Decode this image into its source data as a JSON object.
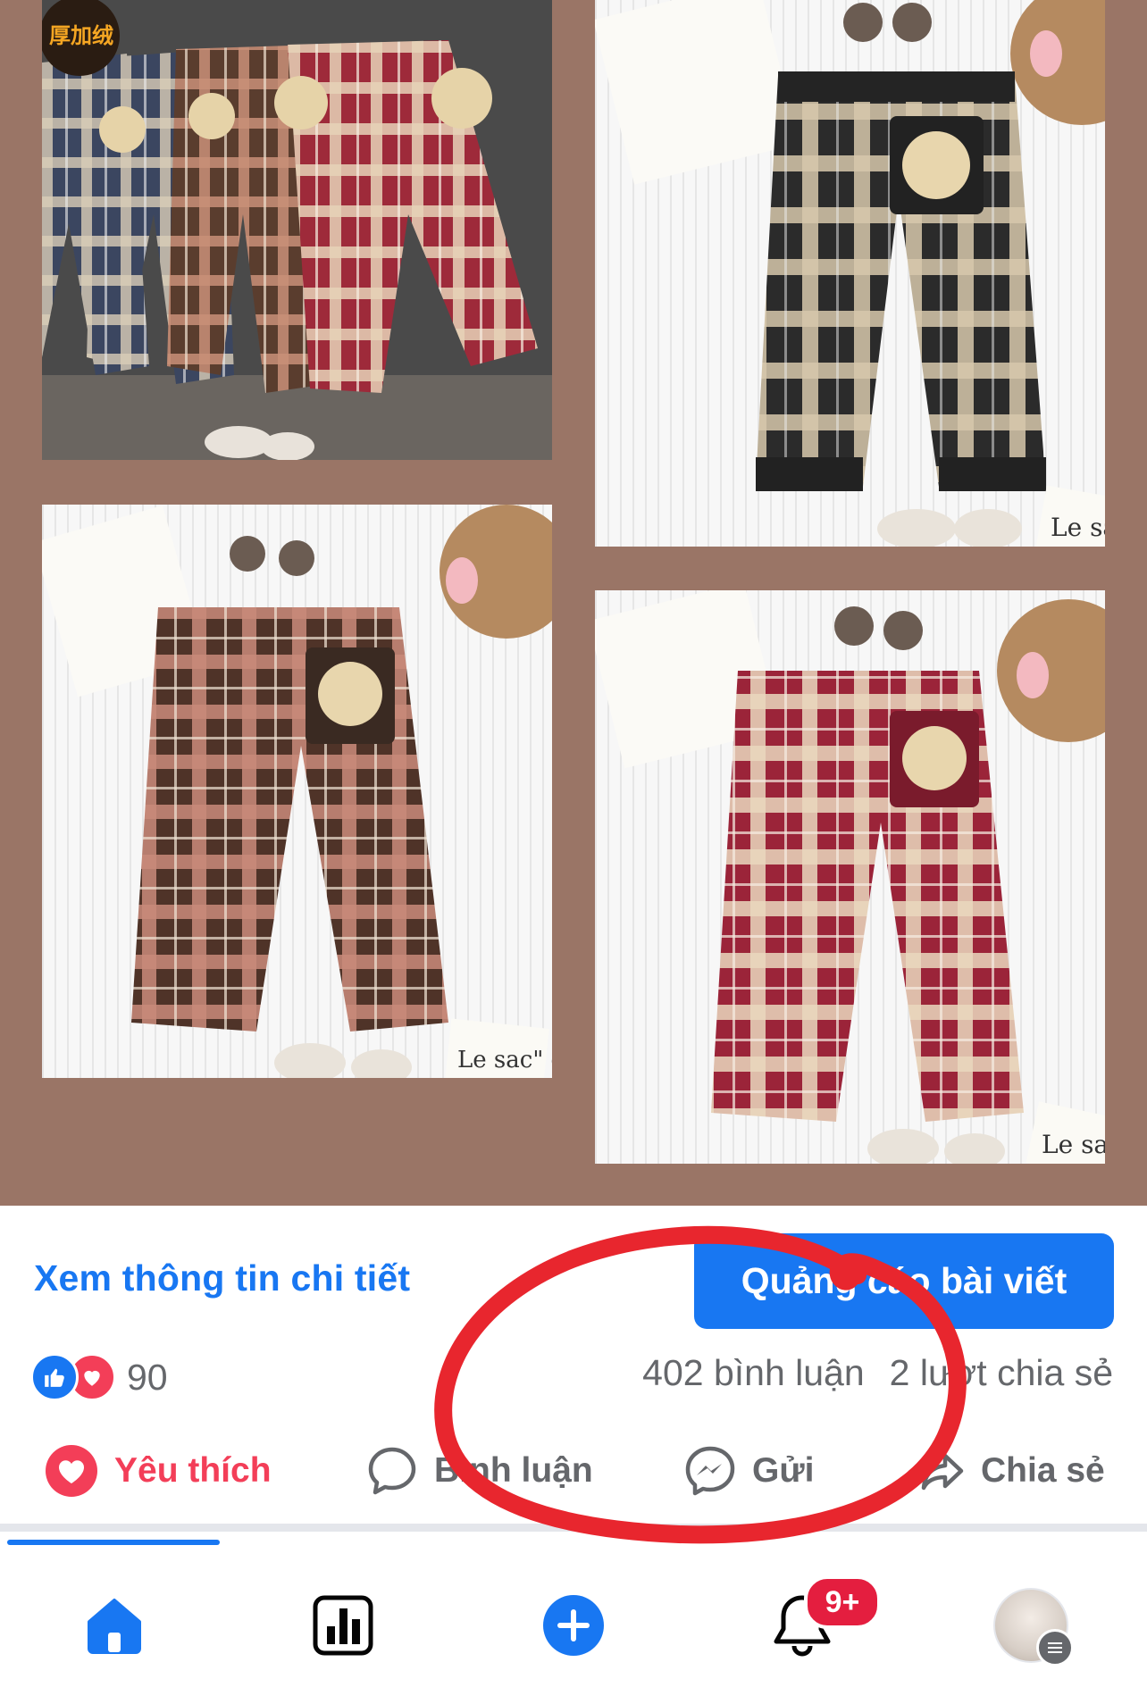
{
  "photos": [
    {
      "name": "plaid pants group",
      "badge_text": "厚加绒"
    },
    {
      "name": "black plaid bear pants",
      "card_text": "Le sac"
    },
    {
      "name": "brown plaid bear pants",
      "card_text": "Le sac\" e"
    },
    {
      "name": "red plaid bear pants",
      "card_text": "Le sa"
    }
  ],
  "post": {
    "details_link": "Xem thông tin chi tiết",
    "boost_button": "Quảng cáo bài viết",
    "reaction_count": "90",
    "comments_count": "402 bình luận",
    "shares_count": "2 lượt chia sẻ"
  },
  "actions": {
    "love": "Yêu thích",
    "comment": "Bình luận",
    "send": "Gửi",
    "share": "Chia sẻ"
  },
  "nav": {
    "active": "home",
    "notifications_badge": "9+"
  },
  "colors": {
    "accent": "#1877f2",
    "love": "#f33e58",
    "badge": "#e41e3f",
    "annotation": "#e8262e",
    "collage_background": "#9a7566"
  }
}
